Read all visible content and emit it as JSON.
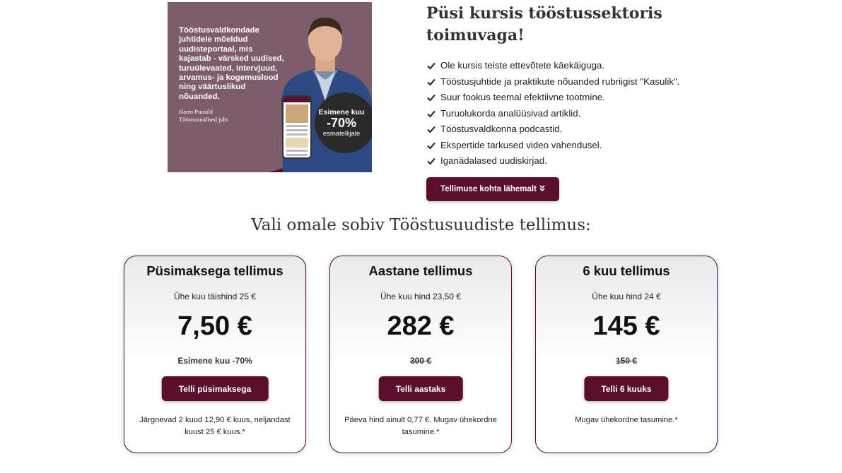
{
  "banner": {
    "text": "Tööstusvaldkondade juhtidele mõeldud uudisteportaal, mis kajastab - värsked uudised, turuülevaated, intervjuud, arvamus- ja kogemuslood ning väärtuslikud nõuanded.",
    "sign_name": "Harro Puusild",
    "sign_role": "Tööstusuudised juht",
    "promo_line1": "Esimene kuu",
    "promo_line2": "-70%",
    "promo_line3": "esmatellijale"
  },
  "info": {
    "headline": "Püsi kursis tööstussektoris toimuvaga!",
    "features": [
      "Ole kursis teiste ettevõtete käekäiguga.",
      "Tööstusjuhtide ja praktikute nõuanded rubriigist \"Kasulik\".",
      "Suur fookus teemal efektiivne tootmine.",
      "Turuolukorda analüüsivad artiklid.",
      "Tööstusvaldkonna podcastid.",
      "Ekspertide tarkused video vahendusel.",
      "Iganädalased uudiskirjad."
    ],
    "more_button": "Tellimuse kohta lähemalt",
    "more_icon": "»"
  },
  "section_title": "Vali omale sobiv Tööstusuudiste tellimus:",
  "plans": [
    {
      "title": "Püsimaksega tellimus",
      "subtitle": "Ühe kuu täishind 25 €",
      "price": "7,50 €",
      "note": "Esimene kuu -70%",
      "button": "Telli püsimaksega",
      "footnote": "Järgnevad 2 kuud 12,90 € kuus, neljandast kuust 25 € kuus.*"
    },
    {
      "title": "Aastane tellimus",
      "subtitle": "Ühe kuu hind 23,50 €",
      "price": "282 €",
      "note": "300 €",
      "button": "Telli aastaks",
      "footnote": "Päeva hind ainult 0,77 €. Mugav ühekordne tasumine.*"
    },
    {
      "title": "6 kuu tellimus",
      "subtitle": "Ühe kuu hind 24 €",
      "price": "145 €",
      "note": "150 €",
      "button": "Telli 6 kuuks",
      "footnote": "Mugav ühekordne tasumine.*"
    }
  ],
  "colors": {
    "brand": "#5a0f2d",
    "banner_bg": "#7d5c6c"
  }
}
